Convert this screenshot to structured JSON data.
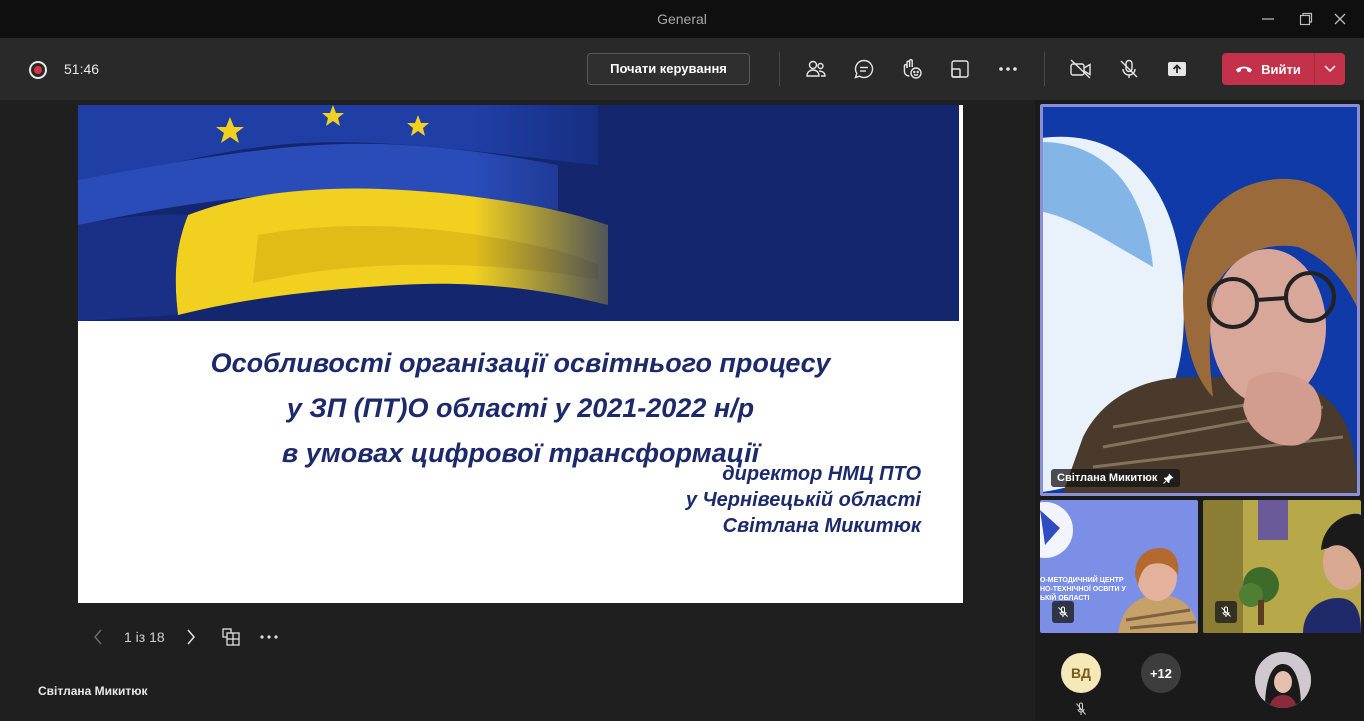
{
  "window": {
    "title": "General"
  },
  "toolbar": {
    "timer": "51:46",
    "control_label": "Почати керування",
    "leave_label": "Вийти"
  },
  "slide": {
    "title_lines": [
      "Особливості організації  освітнього процесу",
      "у  ЗП (ПТ)О області  у 2021-2022 н/р",
      "в умовах цифрової трансформації"
    ],
    "author_lines": [
      "директор  НМЦ ПТО",
      "у Чернівецькій області",
      "Світлана Микитюк"
    ],
    "pager": "1 із 18"
  },
  "stage": {
    "presenter_name": "Світлана Микитюк"
  },
  "participants": {
    "main_name": "Світлана Микитюк",
    "thumb_logo_lines": [
      "О-МЕТОДИЧНИЙ ЦЕНТР",
      "НО-ТЕХНІЧНОЇ ОСВІТИ У",
      "ЬКІЙ ОБЛАСТІ"
    ],
    "initials": "ВД",
    "more_count": "+12"
  },
  "colors": {
    "leave": "#c4314b",
    "active_border": "#8a8fd6",
    "slide_text": "#1c2a6b"
  }
}
